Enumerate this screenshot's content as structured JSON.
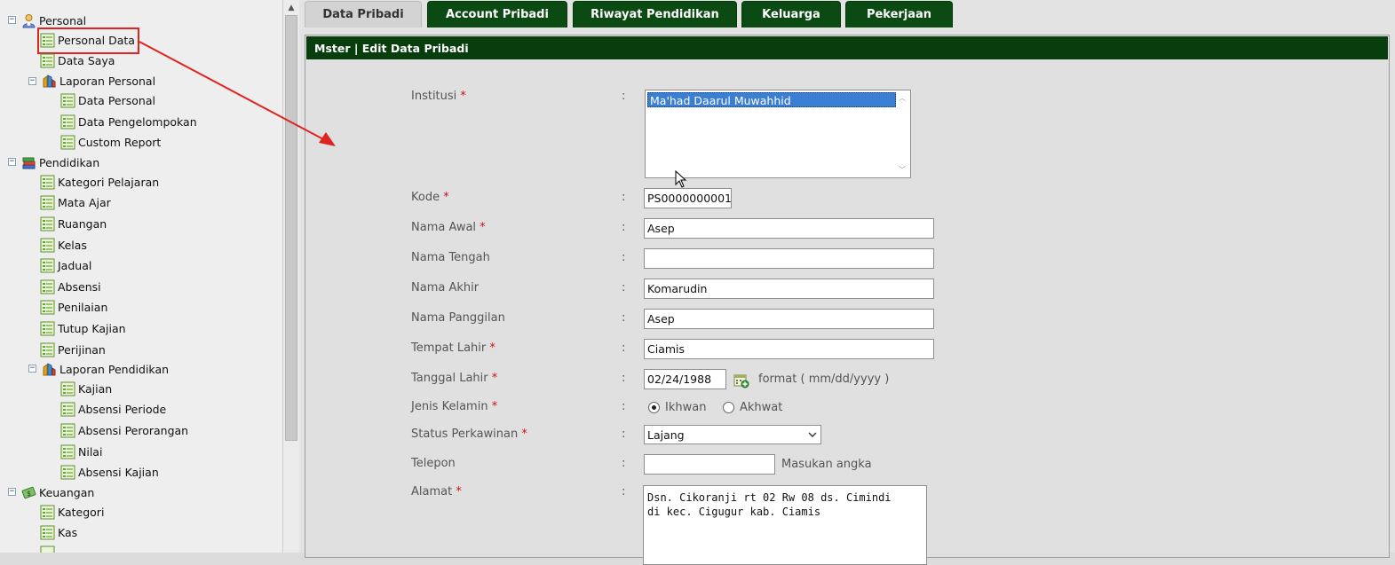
{
  "tree": {
    "personal": "Personal",
    "personal_data": "Personal Data",
    "data_saya": "Data Saya",
    "laporan_personal": "Laporan Personal",
    "data_personal": "Data Personal",
    "data_pengelompokan": "Data Pengelompokan",
    "custom_report": "Custom Report",
    "pendidikan": "Pendidikan",
    "kategori_pelajaran": "Kategori Pelajaran",
    "mata_ajar": "Mata Ajar",
    "ruangan": "Ruangan",
    "kelas": "Kelas",
    "jadual": "Jadual",
    "absensi": "Absensi",
    "penilaian": "Penilaian",
    "tutup_kajian": "Tutup Kajian",
    "perijinan": "Perijinan",
    "laporan_pendidikan": "Laporan Pendidikan",
    "kajian": "Kajian",
    "absensi_periode": "Absensi Periode",
    "absensi_perorangan": "Absensi Perorangan",
    "nilai": "Nilai",
    "absensi_kajian": "Absensi Kajian",
    "keuangan": "Keuangan",
    "kategori": "Kategori",
    "kas": "Kas"
  },
  "tabs": [
    "Data Pribadi",
    "Account Pribadi",
    "Riwayat Pendidikan",
    "Keluarga",
    "Pekerjaan"
  ],
  "panel": {
    "title": "Mster | Edit Data Pribadi"
  },
  "form": {
    "colon": ":",
    "required_mark": "*",
    "institusi": {
      "label": "Institusi",
      "selected": "Ma'had Daarul Muwahhid"
    },
    "kode": {
      "label": "Kode",
      "value": "PS0000000001"
    },
    "nama_awal": {
      "label": "Nama Awal",
      "value": "Asep"
    },
    "nama_tengah": {
      "label": "Nama Tengah",
      "value": ""
    },
    "nama_akhir": {
      "label": "Nama Akhir",
      "value": "Komarudin"
    },
    "nama_panggilan": {
      "label": "Nama Panggilan",
      "value": "Asep"
    },
    "tempat_lahir": {
      "label": "Tempat Lahir",
      "value": "Ciamis"
    },
    "tanggal_lahir": {
      "label": "Tanggal Lahir",
      "value": "02/24/1988",
      "hint": "format ( mm/dd/yyyy )"
    },
    "jenis_kelamin": {
      "label": "Jenis Kelamin",
      "option_1": "Ikhwan",
      "option_2": "Akhwat",
      "selected": "Ikhwan"
    },
    "status_perkawinan": {
      "label": "Status Perkawinan",
      "value": "Lajang"
    },
    "telepon": {
      "label": "Telepon",
      "value": "",
      "hint": "Masukan angka"
    },
    "alamat": {
      "label": "Alamat",
      "value": "Dsn. Cikoranji rt 02 Rw 08 ds. Cimindi\ndi kec. Cigugur kab. Ciamis"
    }
  },
  "colors": {
    "tab_green": "#0b4a12",
    "header_green": "#083d0d",
    "annotation_red": "#e0231f",
    "selection_blue": "#3a7fd4"
  }
}
